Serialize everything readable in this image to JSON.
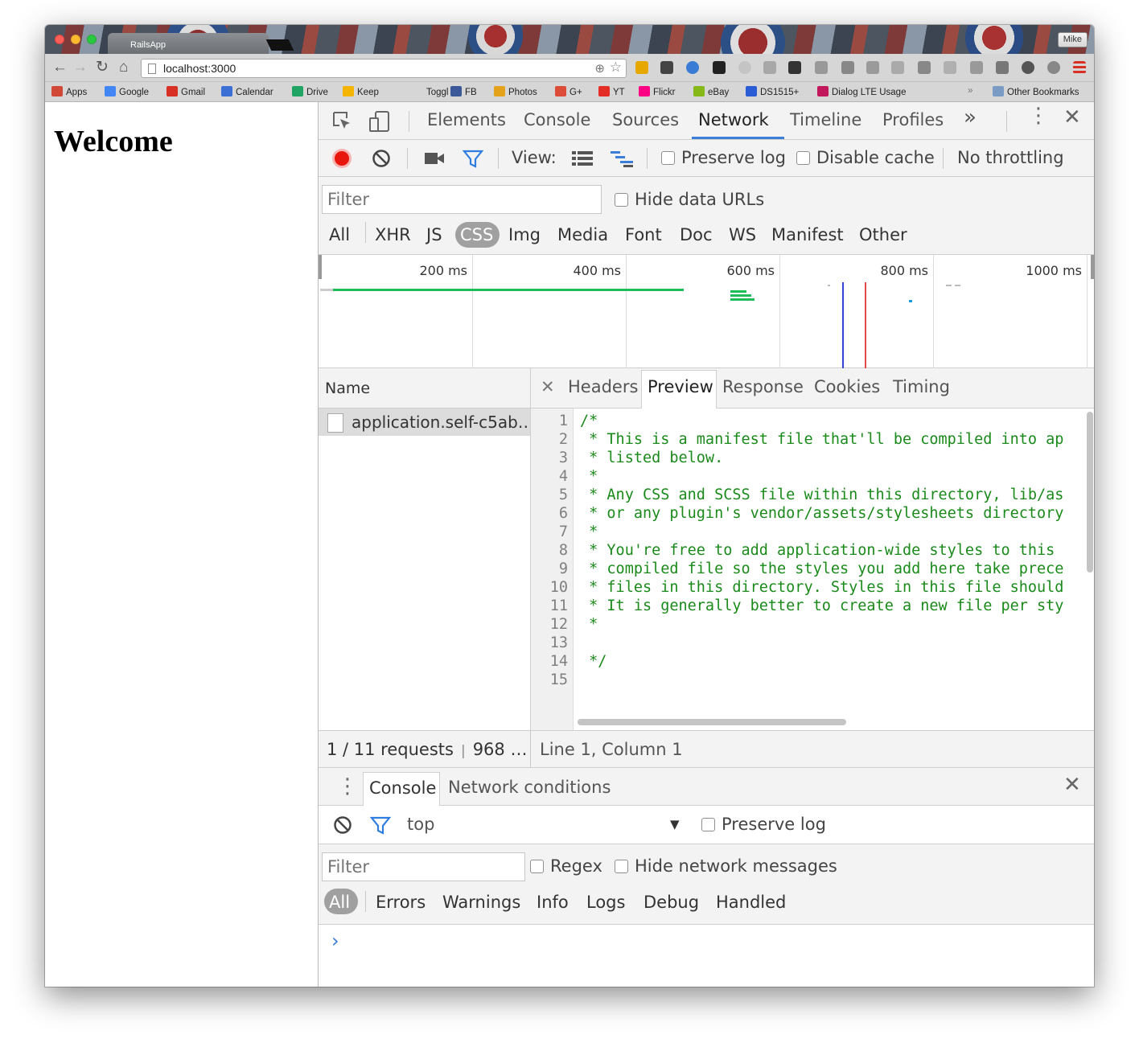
{
  "browser": {
    "tab_title": "RailsApp",
    "profile_name": "Mike",
    "address": "localhost:3000",
    "bookmarks": [
      {
        "label": "Apps",
        "color": "#d14836"
      },
      {
        "label": "Google",
        "color": "#4285f4"
      },
      {
        "label": "Gmail",
        "color": "#d93025"
      },
      {
        "label": "Calendar",
        "color": "#3b6fd6"
      },
      {
        "label": "Drive",
        "color": "#1fa463"
      },
      {
        "label": "Keep",
        "color": "#f4b400"
      },
      {
        "label": "Toggl",
        "color": "#d6d6d6"
      },
      {
        "label": "FB",
        "color": "#3b5998"
      },
      {
        "label": "Photos",
        "color": "#e3a21a"
      },
      {
        "label": "G+",
        "color": "#dd4b39"
      },
      {
        "label": "YT",
        "color": "#e52d27"
      },
      {
        "label": "Flickr",
        "color": "#ff0084"
      },
      {
        "label": "eBay",
        "color": "#86b817"
      },
      {
        "label": "DS1515+",
        "color": "#2a5cd6"
      },
      {
        "label": "Dialog LTE Usage",
        "color": "#c2185b"
      }
    ],
    "overflow": "»",
    "other_bookmarks": "Other Bookmarks"
  },
  "page": {
    "heading": "Welcome"
  },
  "devtools": {
    "panels": [
      "Elements",
      "Console",
      "Sources",
      "Network",
      "Timeline",
      "Profiles"
    ],
    "active_panel": "Network",
    "more": "»",
    "view_label": "View:",
    "preserve_log": "Preserve log",
    "disable_cache": "Disable cache",
    "throttling": "No throttling",
    "filter_placeholder": "Filter",
    "hide_data_urls": "Hide data URLs",
    "types": [
      "All",
      "XHR",
      "JS",
      "CSS",
      "Img",
      "Media",
      "Font",
      "Doc",
      "WS",
      "Manifest",
      "Other"
    ],
    "active_type": "CSS",
    "timeline_ticks": [
      "200 ms",
      "400 ms",
      "600 ms",
      "800 ms",
      "1000 ms"
    ],
    "name_header": "Name",
    "request_name": "application.self-c5ab…",
    "detail_tabs": [
      "Headers",
      "Preview",
      "Response",
      "Cookies",
      "Timing"
    ],
    "active_detail_tab": "Preview",
    "code_lines": [
      "/*",
      " * This is a manifest file that'll be compiled into ap",
      " * listed below.",
      " *",
      " * Any CSS and SCSS file within this directory, lib/as",
      " * or any plugin's vendor/assets/stylesheets directory",
      " *",
      " * You're free to add application-wide styles to this",
      " * compiled file so the styles you add here take prece",
      " * files in this directory. Styles in this file should",
      " * It is generally better to create a new file per sty",
      " *",
      "",
      " */",
      ""
    ],
    "line_numbers": [
      "1",
      "2",
      "3",
      "4",
      "5",
      "6",
      "7",
      "8",
      "9",
      "10",
      "11",
      "12",
      "13",
      "14",
      "15"
    ],
    "summary": "1 / 11 requests",
    "summary_size": "968 …",
    "cursor_position": "Line 1, Column 1"
  },
  "drawer": {
    "tabs": [
      "Console",
      "Network conditions"
    ],
    "context": "top",
    "preserve_log": "Preserve log",
    "filter_placeholder": "Filter",
    "regex": "Regex",
    "hide_network": "Hide network messages",
    "levels": [
      "All",
      "Errors",
      "Warnings",
      "Info",
      "Logs",
      "Debug",
      "Handled"
    ],
    "prompt": "›"
  }
}
